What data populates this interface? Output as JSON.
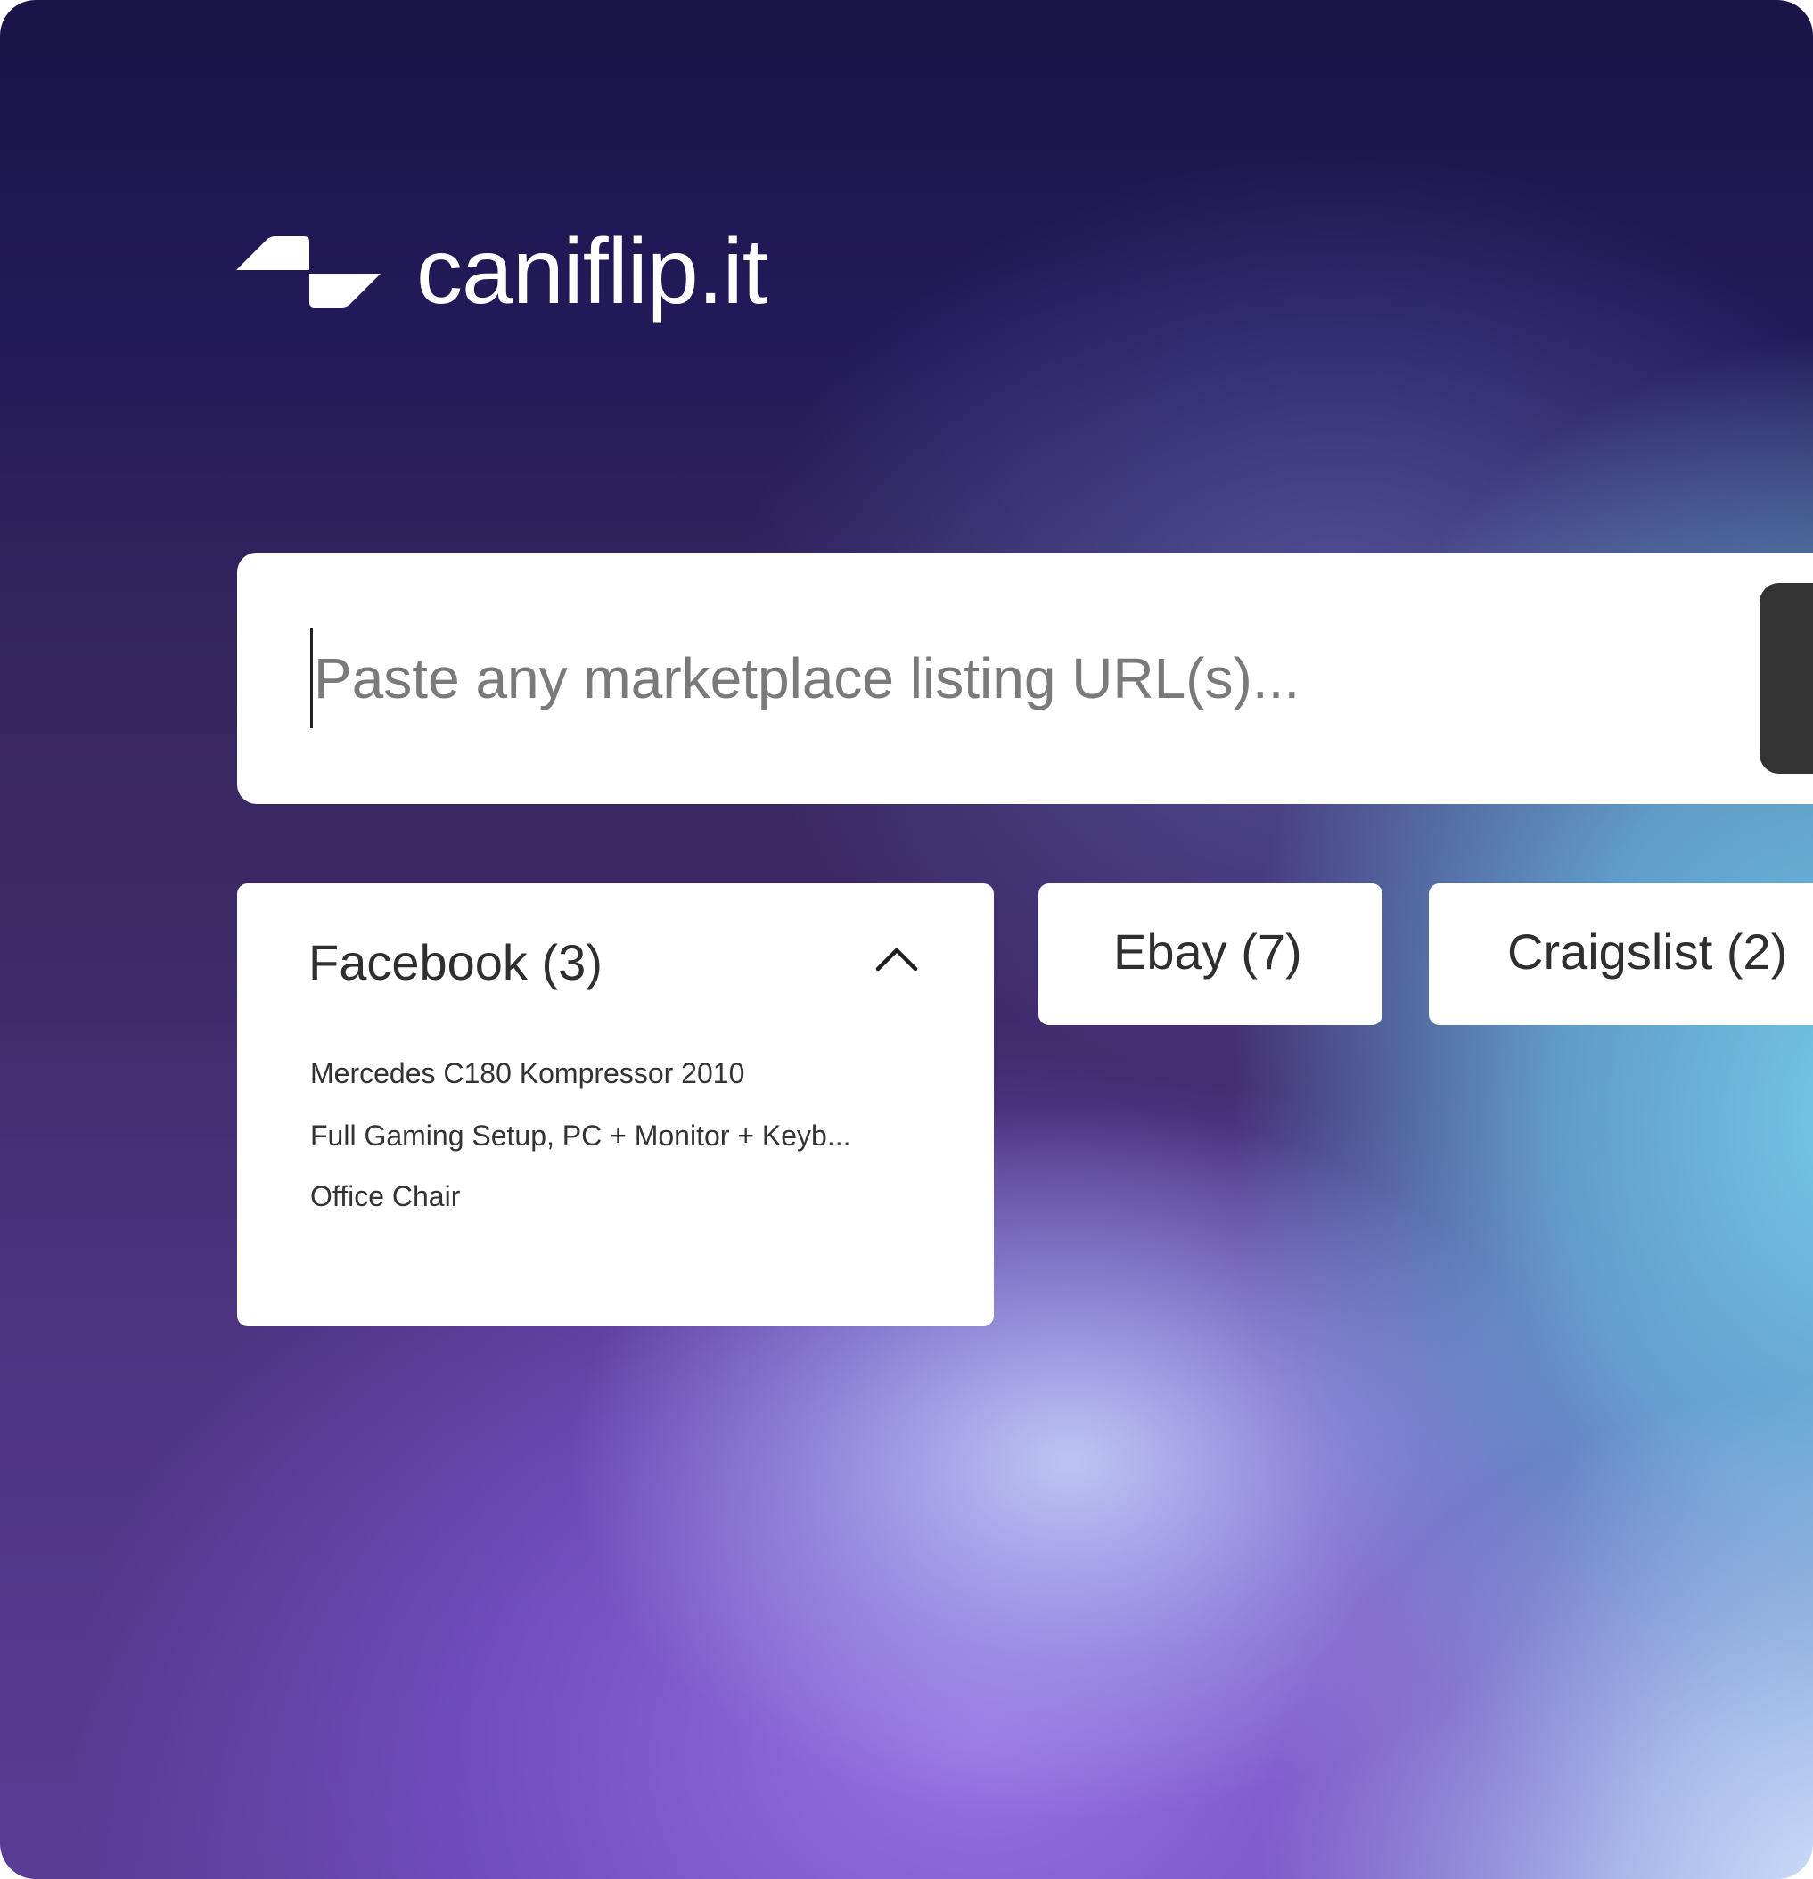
{
  "brand": {
    "name": "caniflip.it",
    "logo_icon": "caniflip-logo-icon"
  },
  "search": {
    "placeholder": "Paste any marketplace listing URL(s)...",
    "value": ""
  },
  "marketplaces": {
    "facebook": {
      "label": "Facebook (3)",
      "expanded": true,
      "chevron_icon": "chevron-up-icon",
      "listings": [
        "Mercedes C180 Kompressor 2010",
        "Full Gaming Setup, PC + Monitor + Keyb...",
        "Office Chair"
      ]
    },
    "ebay": {
      "label": "Ebay (7)"
    },
    "craigslist": {
      "label": "Craigslist (2)"
    }
  },
  "colors": {
    "background_top": "#1a1447",
    "background_bottom_right": "#7fd8f2",
    "card": "#ffffff",
    "submit_button": "#333333",
    "placeholder_text": "#7a7a7a"
  }
}
